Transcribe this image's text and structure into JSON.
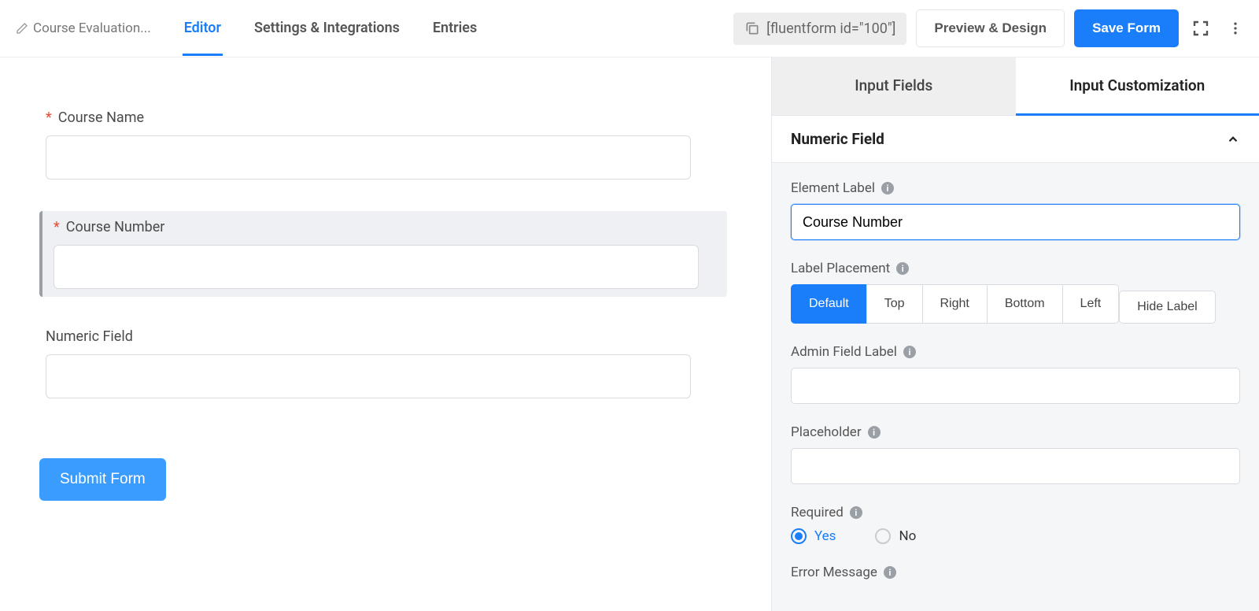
{
  "header": {
    "title": "Course Evaluation...",
    "tabs": {
      "editor": "Editor",
      "settings": "Settings & Integrations",
      "entries": "Entries"
    },
    "shortcode": "[fluentform id=\"100\"]",
    "preview_btn": "Preview & Design",
    "save_btn": "Save Form"
  },
  "form": {
    "fields": [
      {
        "label": "Course Name",
        "required": true
      },
      {
        "label": "Course Number",
        "required": true
      },
      {
        "label": "Numeric Field",
        "required": false
      }
    ],
    "submit_label": "Submit Form"
  },
  "sidebar": {
    "tabs": {
      "fields": "Input Fields",
      "custom": "Input Customization"
    },
    "section_title": "Numeric Field",
    "element_label": {
      "label": "Element Label",
      "value": "Course Number"
    },
    "label_placement": {
      "label": "Label Placement",
      "options": [
        "Default",
        "Top",
        "Right",
        "Bottom",
        "Left",
        "Hide Label"
      ],
      "selected": "Default"
    },
    "admin_field_label": {
      "label": "Admin Field Label",
      "value": ""
    },
    "placeholder": {
      "label": "Placeholder",
      "value": ""
    },
    "required": {
      "label": "Required",
      "yes": "Yes",
      "no": "No",
      "value": "Yes"
    },
    "error_message": {
      "label": "Error Message"
    }
  }
}
